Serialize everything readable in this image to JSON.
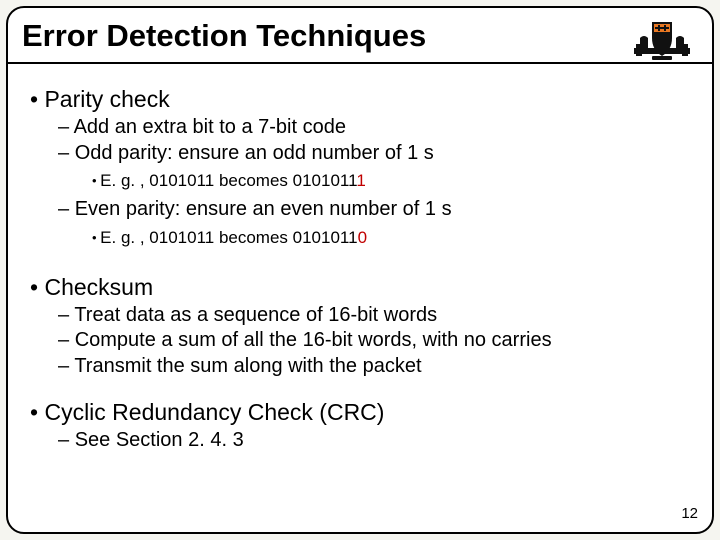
{
  "title": "Error Detection Techniques",
  "page_number": "12",
  "sections": [
    {
      "heading": "Parity check",
      "lvl2": [
        "Add an extra bit to a 7-bit code",
        "Odd parity: ensure an odd number of 1 s"
      ],
      "detail1": {
        "prefix": "E. g. , 0101011 becomes 0101011",
        "suffix": "1"
      },
      "lvl2b": "Even parity: ensure an even number of 1 s",
      "detail2": {
        "prefix": "E. g. , 0101011 becomes 0101011",
        "suffix": "0"
      }
    },
    {
      "heading": "Checksum",
      "lvl2": [
        "Treat data as a sequence of 16-bit words",
        "Compute a sum of all the 16-bit words, with no carries",
        "Transmit the sum along with the packet"
      ]
    },
    {
      "heading": "Cyclic Redundancy Check (CRC)",
      "lvl2": [
        "See Section 2. 4. 3"
      ]
    }
  ]
}
